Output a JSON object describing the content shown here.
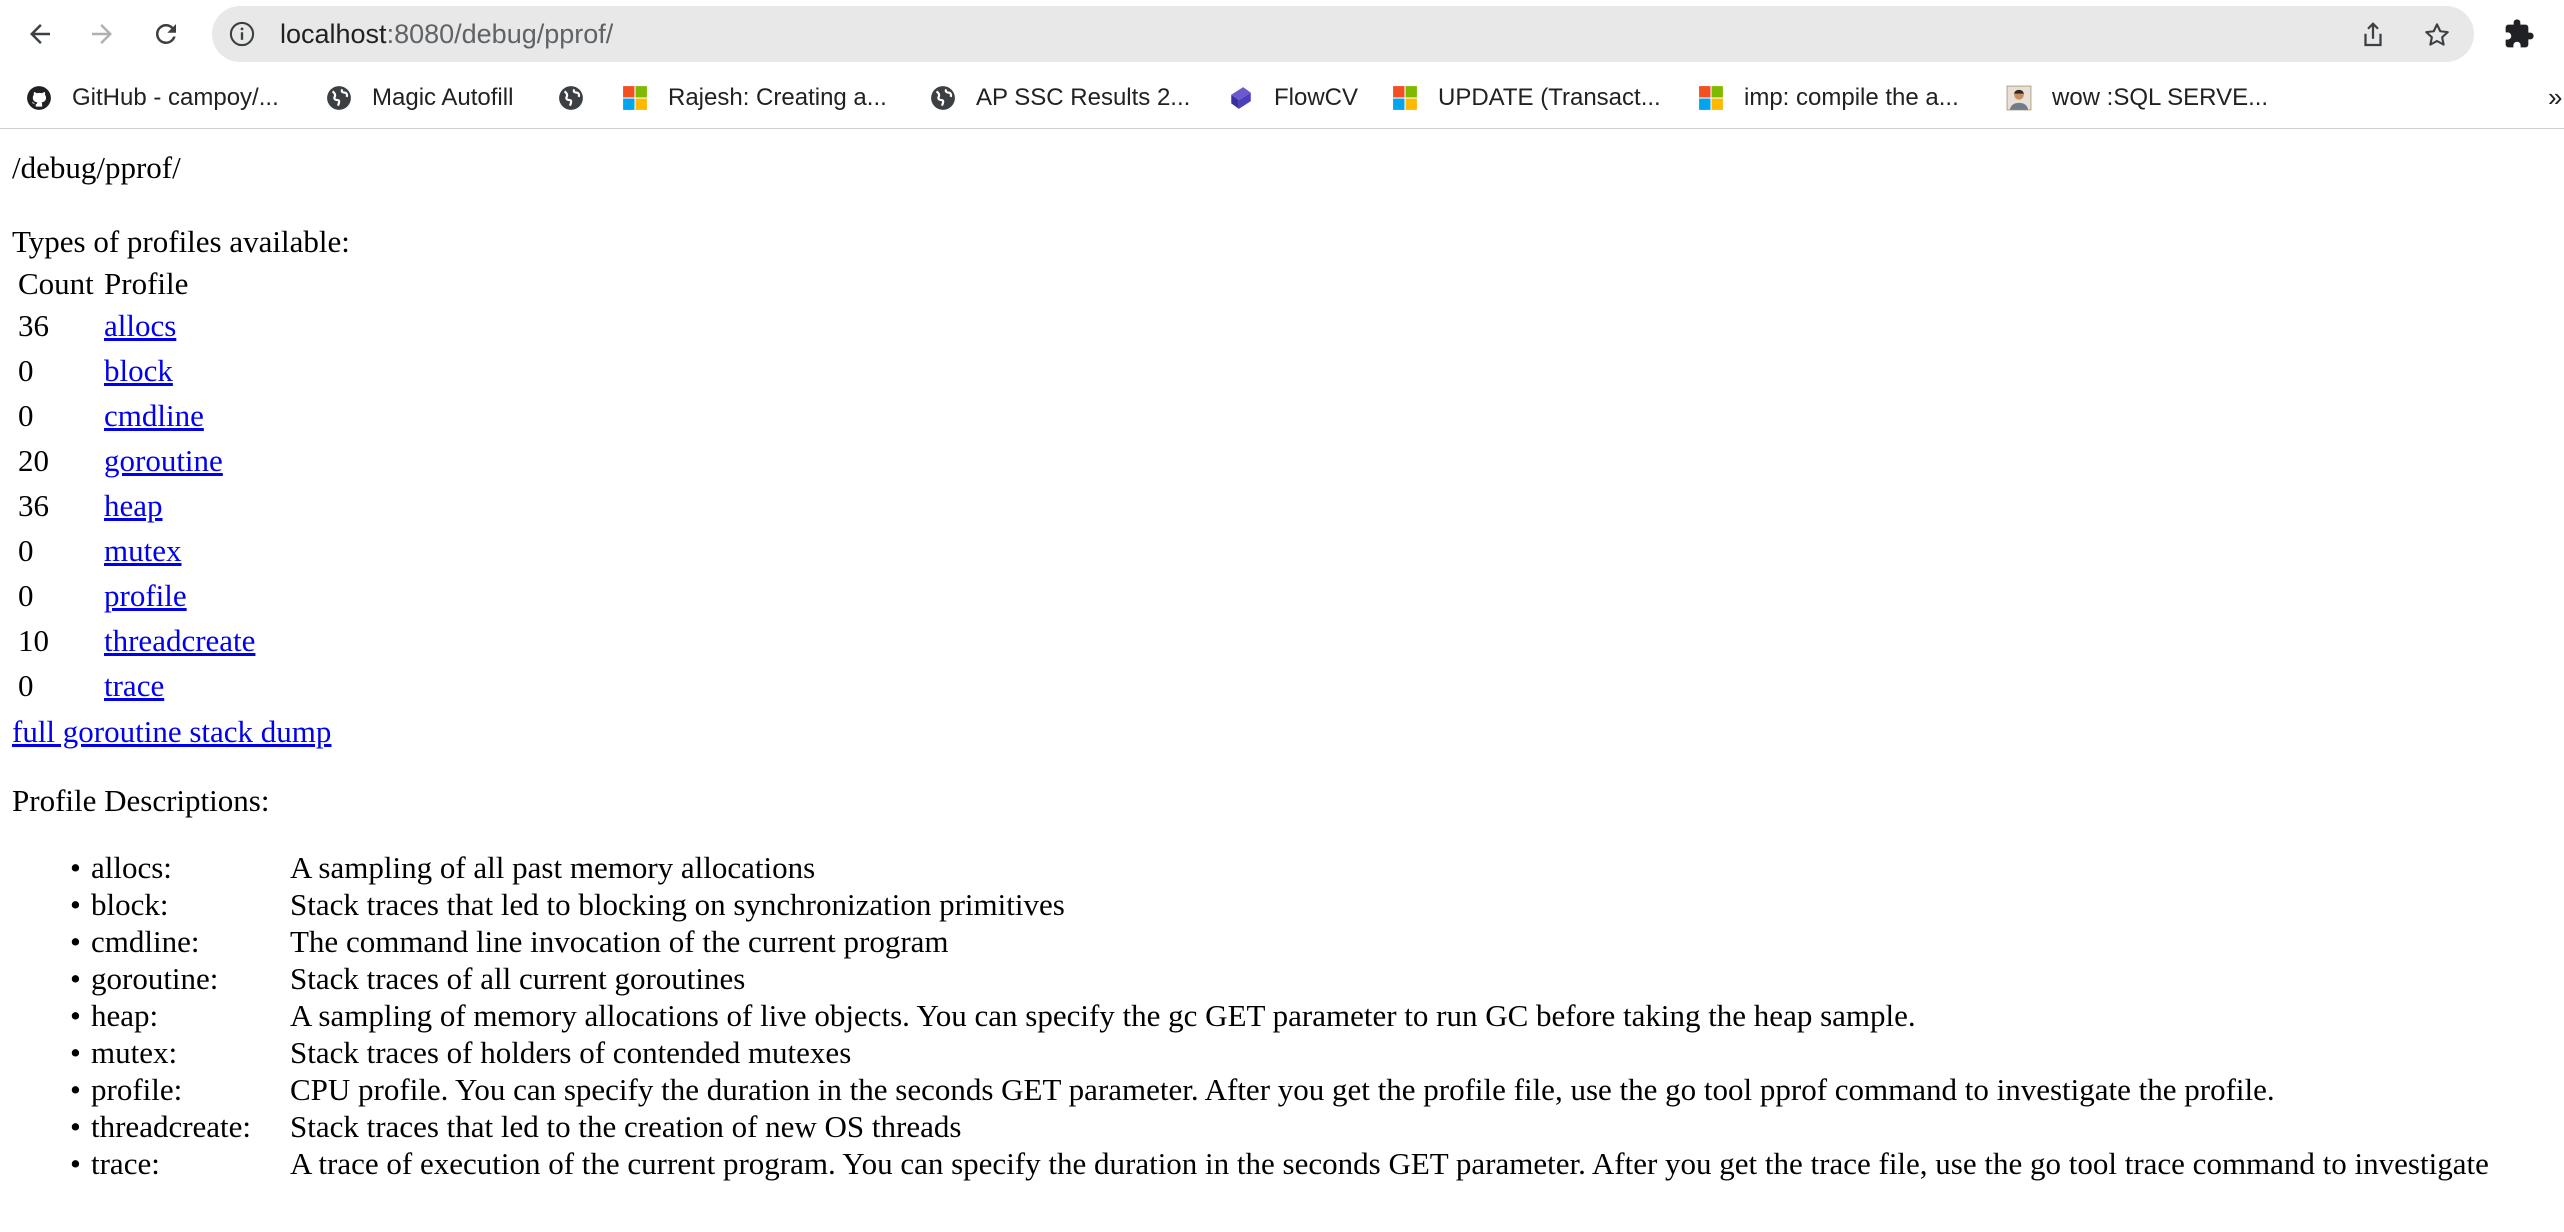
{
  "browser": {
    "url_host": "localhost",
    "url_rest": ":8080/debug/pprof/",
    "bookmarks": [
      {
        "label": "GitHub - campoy/...",
        "icon": "github-icon"
      },
      {
        "label": "Magic Autofill",
        "icon": "globe-icon"
      },
      {
        "label": "",
        "icon": "globe-icon"
      },
      {
        "label": "Rajesh: Creating a...",
        "icon": "microsoft-icon"
      },
      {
        "label": "AP SSC Results 2...",
        "icon": "globe-icon"
      },
      {
        "label": "FlowCV",
        "icon": "flowcv-icon"
      },
      {
        "label": "UPDATE (Transact...",
        "icon": "microsoft-icon"
      },
      {
        "label": "imp: compile the a...",
        "icon": "microsoft-icon"
      },
      {
        "label": "wow :SQL SERVE...",
        "icon": "avatar-icon"
      }
    ],
    "more_label": "»"
  },
  "page": {
    "path": "/debug/pprof/",
    "types_heading": "Types of profiles available:",
    "table": {
      "headers": {
        "count": "Count",
        "profile": "Profile"
      },
      "rows": [
        {
          "count": "36",
          "profile": "allocs"
        },
        {
          "count": "0",
          "profile": "block"
        },
        {
          "count": "0",
          "profile": "cmdline"
        },
        {
          "count": "20",
          "profile": "goroutine"
        },
        {
          "count": "36",
          "profile": "heap"
        },
        {
          "count": "0",
          "profile": "mutex"
        },
        {
          "count": "0",
          "profile": "profile"
        },
        {
          "count": "10",
          "profile": "threadcreate"
        },
        {
          "count": "0",
          "profile": "trace"
        }
      ]
    },
    "dump_link": "full goroutine stack dump",
    "desc_heading": "Profile Descriptions:",
    "descriptions": [
      {
        "name": "allocs:",
        "text": "A sampling of all past memory allocations"
      },
      {
        "name": "block:",
        "text": "Stack traces that led to blocking on synchronization primitives"
      },
      {
        "name": "cmdline:",
        "text": "The command line invocation of the current program"
      },
      {
        "name": "goroutine:",
        "text": "Stack traces of all current goroutines"
      },
      {
        "name": "heap:",
        "text": "A sampling of memory allocations of live objects. You can specify the gc GET parameter to run GC before taking the heap sample."
      },
      {
        "name": "mutex:",
        "text": "Stack traces of holders of contended mutexes"
      },
      {
        "name": "profile:",
        "text": "CPU profile. You can specify the duration in the seconds GET parameter. After you get the profile file, use the go tool pprof command to investigate the profile."
      },
      {
        "name": "threadcreate:",
        "text": "Stack traces that led to the creation of new OS threads"
      },
      {
        "name": "trace:",
        "text": "A trace of execution of the current program. You can specify the duration in the seconds GET parameter. After you get the trace file, use the go tool trace command to investigate"
      }
    ]
  }
}
